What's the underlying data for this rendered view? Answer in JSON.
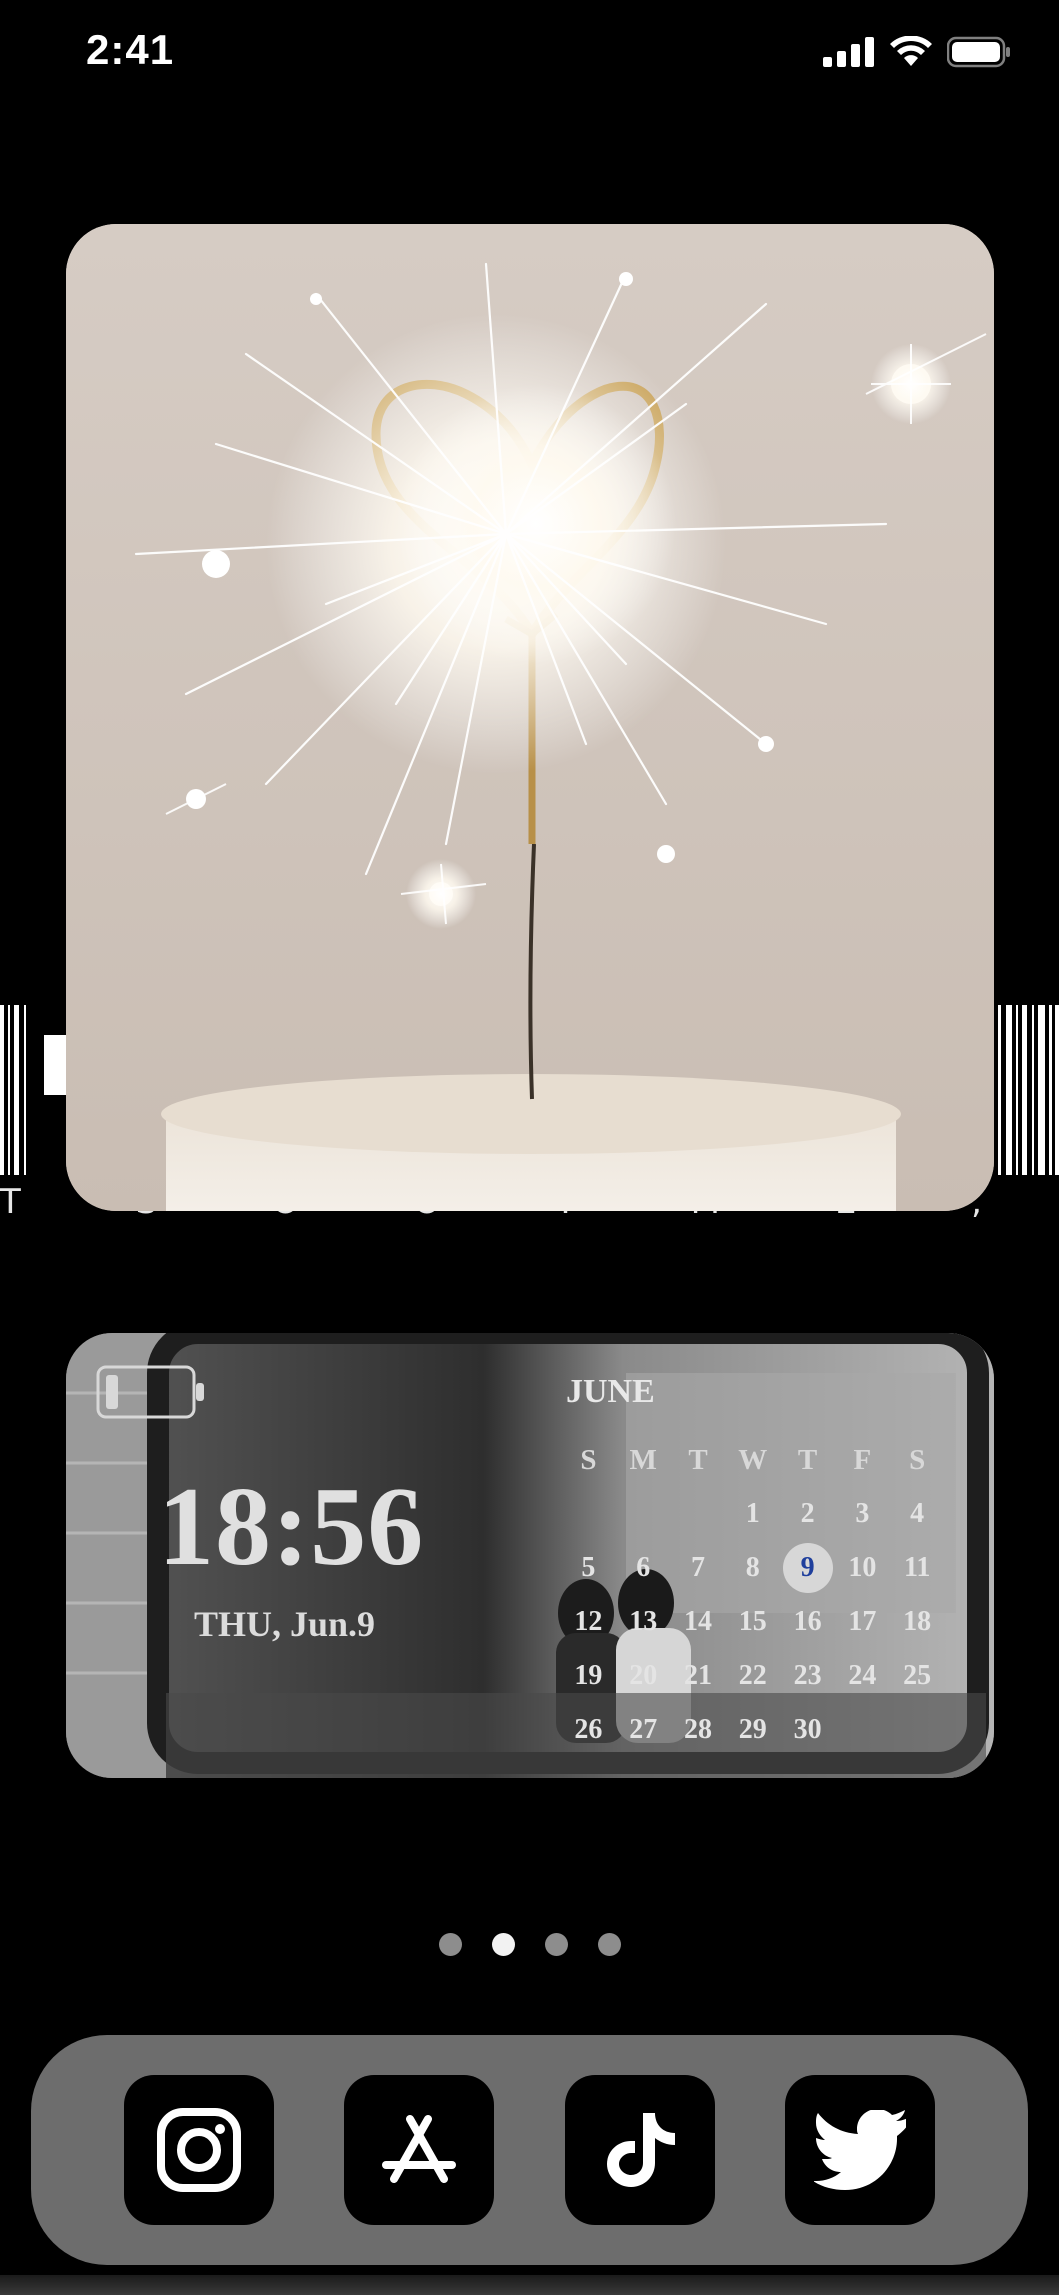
{
  "status_bar": {
    "time": "2:41",
    "signal_icon": "cellular-signal-icon",
    "wifi_icon": "wifi-icon",
    "battery_icon": "battery-icon"
  },
  "background": {
    "text": "T S O O T M E , M I S E L F A N D I",
    "barcode_icon": "barcode-icon"
  },
  "photo_widget": {
    "subject": "heart sparkler on cake",
    "colors": {
      "bg": "#d2c7bf",
      "cake": "#efe9e1",
      "sparkle": "#ffffff",
      "heart": "#c9a35a"
    }
  },
  "calendar_widget": {
    "battery_icon": "battery-outline-icon",
    "time": "18:56",
    "date": "THU, Jun.9",
    "month": "JUNE",
    "weekdays": [
      "S",
      "M",
      "T",
      "W",
      "T",
      "F",
      "S"
    ],
    "weeks": [
      [
        "",
        "",
        "",
        "1",
        "2",
        "3",
        "4"
      ],
      [
        "5",
        "6",
        "7",
        "8",
        "9",
        "10",
        "11"
      ],
      [
        "12",
        "13",
        "14",
        "15",
        "16",
        "17",
        "18"
      ],
      [
        "19",
        "20",
        "21",
        "22",
        "23",
        "24",
        "25"
      ],
      [
        "26",
        "27",
        "28",
        "29",
        "30",
        "",
        ""
      ]
    ],
    "today": "9",
    "colors": {
      "today_text": "#1f3f9c",
      "today_bg": "#d7d7d7"
    }
  },
  "page_dots": {
    "count": 4,
    "active_index": 1
  },
  "dock": {
    "apps": [
      {
        "name": "Instagram",
        "icon": "instagram-icon"
      },
      {
        "name": "App Store",
        "icon": "app-store-icon"
      },
      {
        "name": "TikTok",
        "icon": "tiktok-icon"
      },
      {
        "name": "Twitter",
        "icon": "twitter-icon"
      }
    ]
  }
}
